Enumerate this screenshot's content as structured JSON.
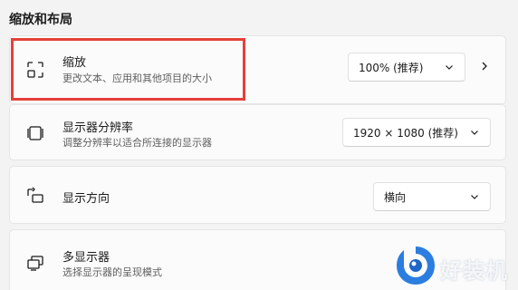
{
  "section": {
    "title": "缩放和布局"
  },
  "rows": [
    {
      "title": "缩放",
      "subtitle": "更改文本、应用和其他项目的大小",
      "icon": "scale-icon",
      "dropdown_value": "100% (推荐)"
    },
    {
      "title": "显示器分辨率",
      "subtitle": "调整分辨率以适合所连接的显示器",
      "icon": "resolution-icon",
      "dropdown_value": "1920 × 1080 (推荐)"
    },
    {
      "title": "显示方向",
      "icon": "orientation-icon",
      "dropdown_value": "横向"
    },
    {
      "title": "多显示器",
      "subtitle": "选择显示器的呈现模式",
      "icon": "multi-display-icon"
    }
  ],
  "watermark": {
    "text": "好装机"
  },
  "colors": {
    "background": "#f3f3f3",
    "card": "#fbfbfb",
    "highlight": "#e5403a",
    "watermark_blue": "#2b7de0"
  }
}
